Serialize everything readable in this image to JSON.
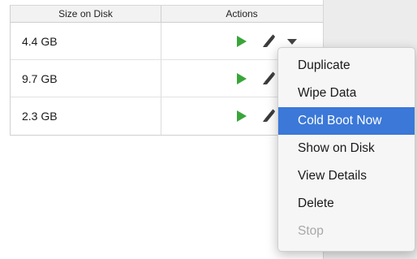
{
  "table": {
    "headers": {
      "size_on_disk": "Size on Disk",
      "actions": "Actions"
    },
    "rows": [
      {
        "size": "4.4 GB"
      },
      {
        "size": "9.7 GB"
      },
      {
        "size": "2.3 GB"
      }
    ],
    "row_action_icons": [
      "play-icon",
      "pencil-icon",
      "chevron-down-icon"
    ]
  },
  "context_menu": {
    "items": [
      {
        "label": "Duplicate",
        "state": "normal"
      },
      {
        "label": "Wipe Data",
        "state": "normal"
      },
      {
        "label": "Cold Boot Now",
        "state": "highlighted"
      },
      {
        "label": "Show on Disk",
        "state": "normal"
      },
      {
        "label": "View Details",
        "state": "normal"
      },
      {
        "label": "Delete",
        "state": "normal"
      },
      {
        "label": "Stop",
        "state": "disabled"
      }
    ]
  },
  "colors": {
    "play_green": "#3aa53a",
    "highlight_blue": "#3b78d8",
    "disabled_gray": "#a8a8a8"
  }
}
